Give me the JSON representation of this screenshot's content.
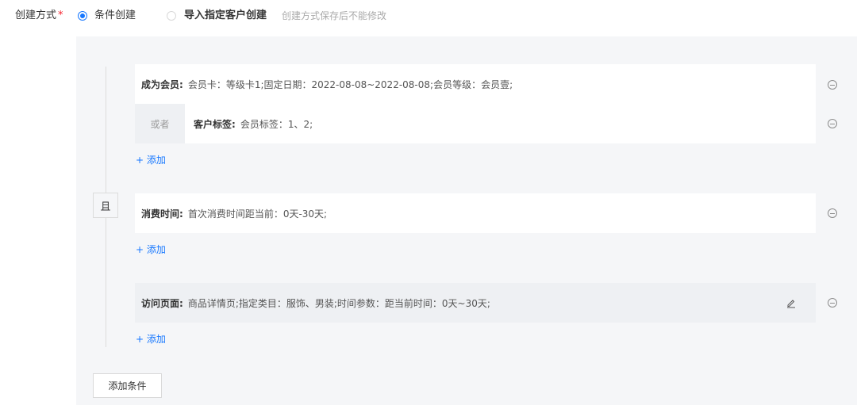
{
  "creation": {
    "label": "创建方式",
    "required_mark": "*",
    "option_condition": "条件创建",
    "option_import": "导入指定客户创建",
    "hint": "创建方式保存后不能修改",
    "selected": "条件创建"
  },
  "groups": [
    {
      "conditions": [
        {
          "key": "成为会员:",
          "value": "会员卡：等级卡1;固定日期：2022-08-08~2022-08-08;会员等级：会员壹;"
        },
        {
          "or_label": "或者",
          "key": "客户标签:",
          "value": "会员标签：1、2;"
        }
      ],
      "add_label": "+ 添加"
    },
    {
      "conditions": [
        {
          "key": "消费时间:",
          "value": "首次消费时间距当前：0天-30天;"
        }
      ],
      "add_label": "+ 添加"
    },
    {
      "conditions": [
        {
          "key": "访问页面:",
          "value": "商品详情页;指定类目：服饰、男装;时间参数：距当前时间：0天~30天;"
        }
      ],
      "add_label": "+ 添加"
    }
  ],
  "and_label": "且",
  "add_condition_label": "添加条件",
  "colors": {
    "accent": "#1677ff",
    "required": "#f5222d",
    "panel": "#f5f6f8"
  }
}
